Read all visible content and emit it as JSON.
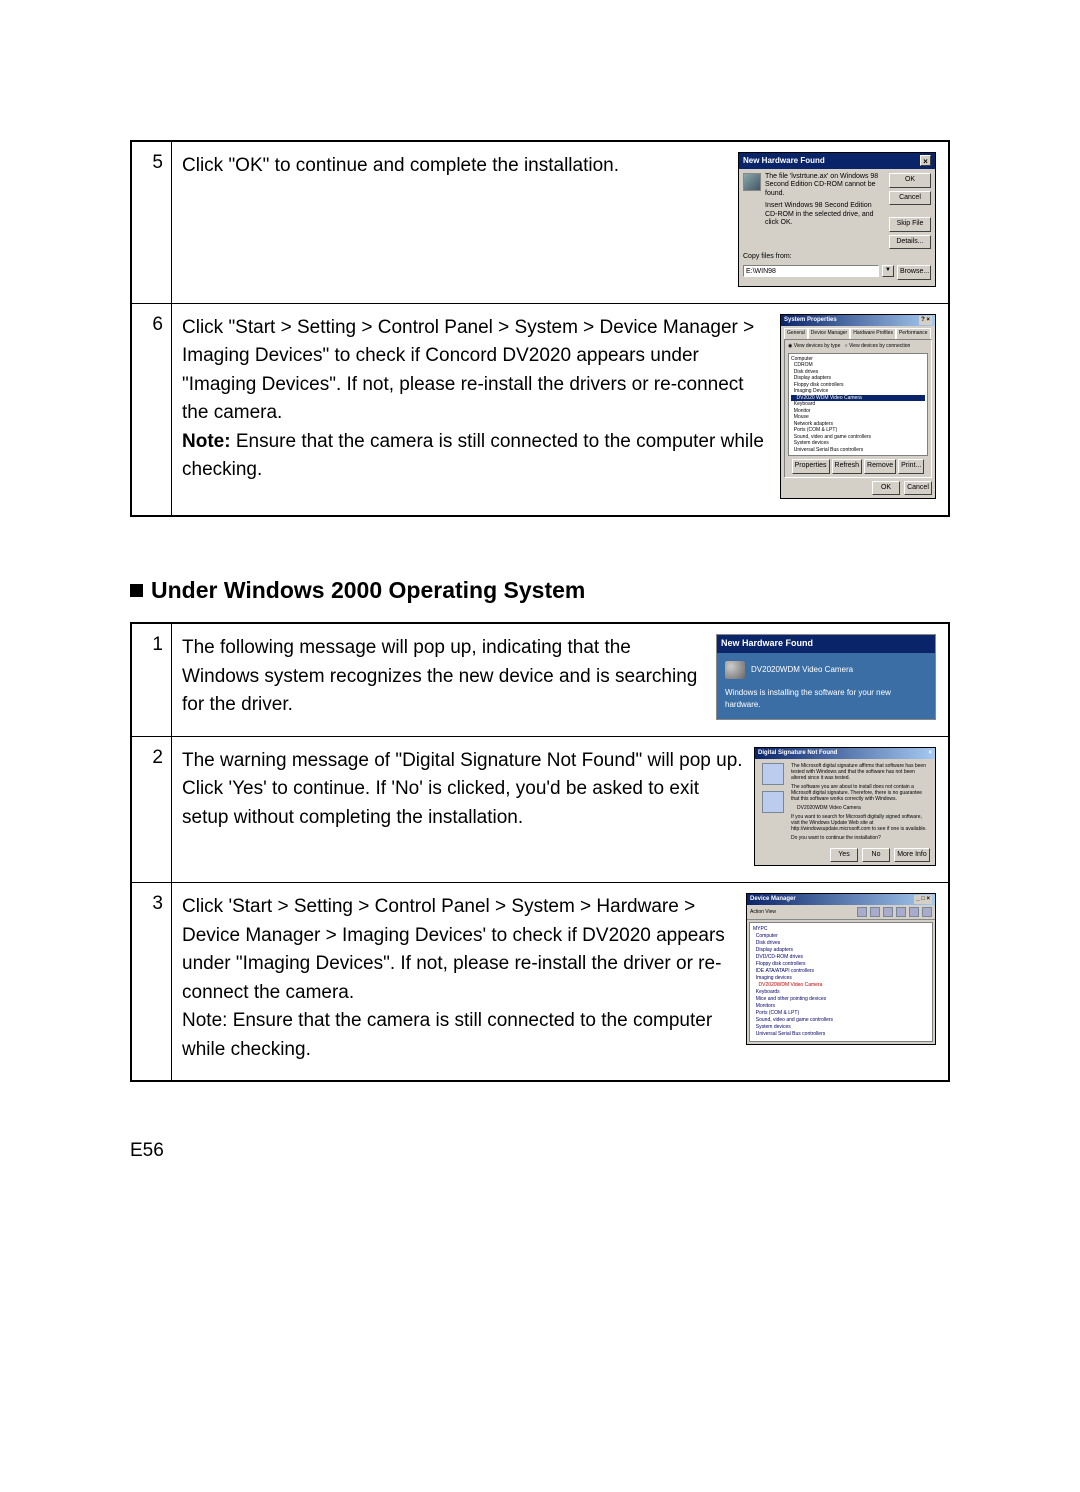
{
  "table1": {
    "rows": [
      {
        "num": "5",
        "text": "Click \"OK\" to continue and complete the installation.",
        "dialog": {
          "title": "New Hardware Found",
          "msg1": "The file 'lvstrtune.ax' on Windows 98 Second Edition CD-ROM cannot be found.",
          "msg2": "Insert Windows 98 Second Edition CD-ROM in the selected drive, and click OK.",
          "copy_label": "Copy files from:",
          "path": "E:\\WIN98",
          "buttons": {
            "ok": "OK",
            "cancel": "Cancel",
            "skip": "Skip File",
            "details": "Details...",
            "browse": "Browse..."
          }
        }
      },
      {
        "num": "6",
        "text_before_note": "Click \"Start > Setting > Control Panel > System > Device Manager > Imaging Devices\" to check if Concord DV2020 appears under \"Imaging Devices\". If not, please re-install the drivers or re-connect the camera.",
        "note_label": "Note:",
        "note_text": " Ensure that the camera is still connected to the computer while checking.",
        "sysprop": {
          "title": "System Properties",
          "tabs": [
            "General",
            "Device Manager",
            "Hardware Profiles",
            "Performance"
          ],
          "radio1": "View devices by type",
          "radio2": "View devices by connection",
          "tree": [
            "Computer",
            "  CDROM",
            "  Disk drives",
            "  Display adapters",
            "  Floppy disk controllers",
            "  Imaging Device",
            "    DV2020 WDM Video Camera",
            "  Keyboard",
            "  Monitor",
            "  Mouse",
            "  Network adapters",
            "  Ports (COM & LPT)",
            "  Sound, video and game controllers",
            "  System devices",
            "  Universal Serial Bus controllers"
          ],
          "sel_index": 6,
          "btns": {
            "props": "Properties",
            "refresh": "Refresh",
            "remove": "Remove",
            "print": "Print..."
          },
          "ok": "OK",
          "cancel": "Cancel"
        }
      }
    ]
  },
  "heading": "Under Windows 2000 Operating System",
  "table2": {
    "rows": [
      {
        "num": "1",
        "text": "The following message will pop up, indicating that the Windows system recognizes the new device and is searching for the driver.",
        "nhf": {
          "title": "New Hardware Found",
          "device": "DV2020WDM Video Camera",
          "msg": "Windows is installing the software for your new hardware."
        }
      },
      {
        "num": "2",
        "text": "The warning message of \"Digital Signature Not Found\" will pop up. Click 'Yes' to continue. If 'No' is clicked, you'd be asked to exit setup without completing the installation.",
        "digsig": {
          "title": "Digital Signature Not Found",
          "p1": "The Microsoft digital signature affirms that software has been tested with Windows and that the software has not been altered since it was tested.",
          "p2": "The software you are about to install does not contain a Microsoft digital signature. Therefore, there is no guarantee that this software works correctly with Windows.",
          "dev": "DV2020WDM Video Camera",
          "p3": "If you want to search for Microsoft digitally signed software, visit the Windows Update Web site at http://windowsupdate.microsoft.com to see if one is available.",
          "p4": "Do you want to continue the installation?",
          "yes": "Yes",
          "no": "No",
          "more": "More Info"
        }
      },
      {
        "num": "3",
        "text": "Click 'Start > Setting > Control Panel > System > Hardware > Device Manager > Imaging Devices' to check if DV2020 appears under \"Imaging Devices\".  If not, please re-install the driver or re-connect the camera.\nNote: Ensure that the camera is still connected to the computer while checking.",
        "devmgr": {
          "title": "Device Manager",
          "menu": "Action  View",
          "tree": [
            "MYPC",
            "  Computer",
            "  Disk drives",
            "  Display adapters",
            "  DVD/CD-ROM drives",
            "  Floppy disk controllers",
            "  IDE ATA/ATAPI controllers",
            "  Imaging devices",
            "    DV2020WDM Video Camera",
            "  Keyboards",
            "  Mice and other pointing devices",
            "  Monitors",
            "  Ports (COM & LPT)",
            "  Sound, video and game controllers",
            "  System devices",
            "  Universal Serial Bus controllers"
          ],
          "sel_index": 8
        }
      }
    ]
  },
  "page_number": "E56"
}
